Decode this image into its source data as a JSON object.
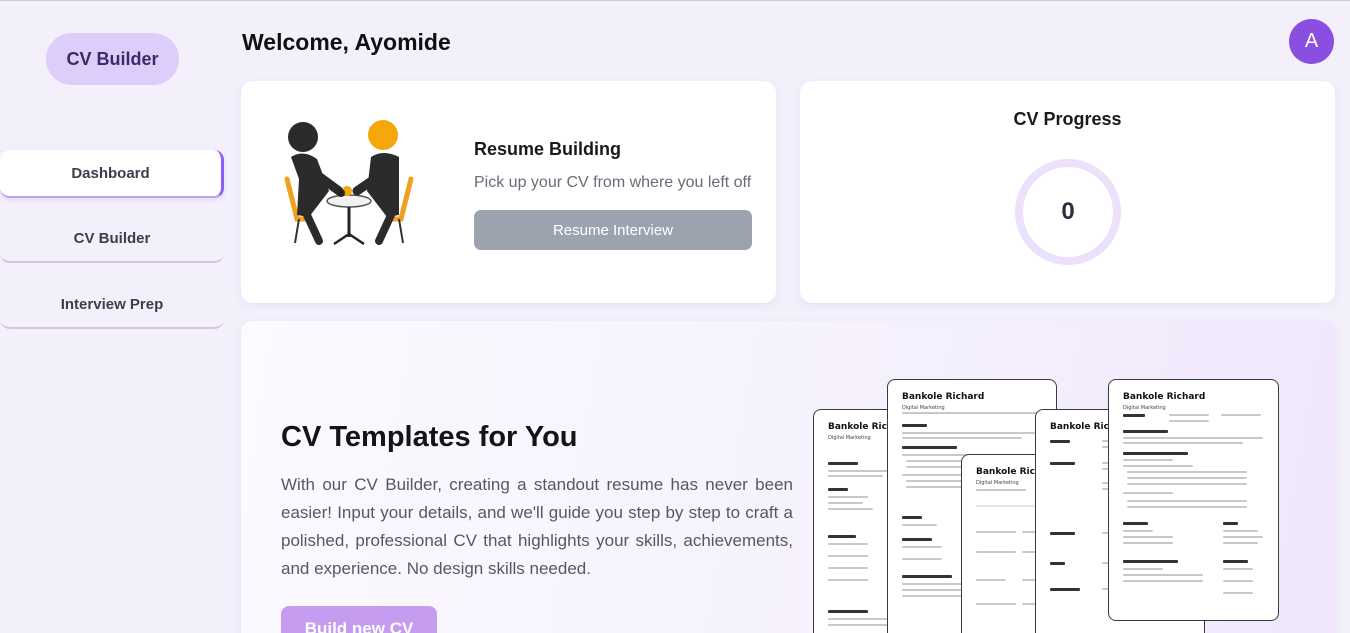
{
  "sidebar": {
    "brand": "CV Builder",
    "items": [
      {
        "label": "Dashboard"
      },
      {
        "label": "CV Builder"
      },
      {
        "label": "Interview Prep"
      }
    ]
  },
  "header": {
    "welcome": "Welcome, Ayomide",
    "avatar_initial": "A"
  },
  "resume_card": {
    "title": "Resume Building",
    "subtitle": "Pick up your CV from where you left off",
    "button": "Resume Interview"
  },
  "progress_card": {
    "title": "CV Progress",
    "value": "0"
  },
  "templates": {
    "title": "CV Templates for You",
    "body": "With our CV Builder, creating a standout resume has never been easier! Input your details, and we'll guide you step by step to craft a polished, professional CV that highlights your skills, achievements, and experience. No design skills needed.",
    "button": "Build new CV",
    "previews": [
      {
        "name": "Bankole Richard",
        "role": "Digital Marketing"
      },
      {
        "name": "Bankole Richard",
        "role": "Digital Marketing"
      },
      {
        "name": "Bankole Richard",
        "role": "Digital Marketing"
      },
      {
        "name": "Bankole Richard",
        "role": ""
      },
      {
        "name": "Bankole Richard",
        "role": "Digital Marketing"
      }
    ]
  },
  "colors": {
    "accent": "#8b5cf6",
    "brand_pill": "#dccdfb",
    "avatar": "#8a4fe0",
    "disabled_button": "#9ca3af",
    "build_button": "#c69cf0",
    "ring": "#ebe1fb"
  },
  "icons": [
    "avatar",
    "handshake-illustration"
  ]
}
